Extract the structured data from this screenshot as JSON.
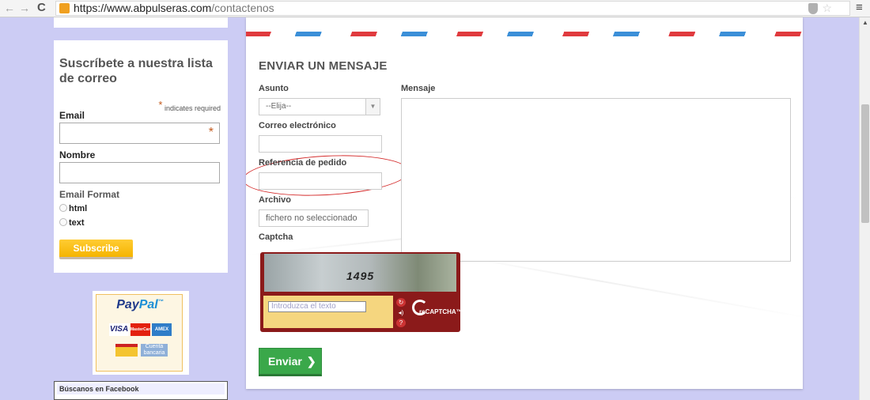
{
  "browser": {
    "url_host": "https://www.abpulseras.com",
    "url_path": "/contactenos",
    "back_glyph": "←",
    "forward_glyph": "→",
    "reload_glyph": "C",
    "star_glyph": "☆",
    "menu_glyph": "≡"
  },
  "sidebar": {
    "subscribe": {
      "title": "Suscríbete a nuestra lista de correo",
      "required_marker": "*",
      "required_note": "indicates required",
      "email_label": "Email",
      "email_value": "",
      "name_label": "Nombre",
      "name_value": "",
      "format_label": "Email Format",
      "format_options": [
        "html",
        "text"
      ],
      "button_label": "Subscribe"
    },
    "paypal": {
      "logo_part1": "Pay",
      "logo_part2": "Pal",
      "trademark": "™",
      "card_visa": "VISA",
      "card_mastercard": "MasterCard",
      "card_amex": "AMEX",
      "bank_label": "Cuenta bancaria"
    },
    "facebook_title": "Búscanos en Facebook"
  },
  "form": {
    "title": "ENVIAR UN MENSAJE",
    "subject_label": "Asunto",
    "subject_selected": "--Elija--",
    "email_label": "Correo electrónico",
    "order_ref_label": "Referencia de pedido",
    "file_label": "Archivo",
    "file_status": "fichero no seleccionado",
    "captcha_label": "Captcha",
    "message_label": "Mensaje",
    "submit_label": "Enviar",
    "submit_chevron": "❯"
  },
  "captcha": {
    "challenge_text": "1495",
    "input_placeholder": "Introduzca el texto",
    "brand": "reCAPTCHA™",
    "refresh_glyph": "↻",
    "audio_glyph": "◂)",
    "help_glyph": "?"
  },
  "colors": {
    "page_background": "#ccccf4",
    "subscribe_button": "#f5b400",
    "submit_button": "#3aa84a",
    "captcha_frame": "#8b1a1a",
    "annotation_ellipse": "#d42a2a",
    "stripe_red": "#e03a3e",
    "stripe_blue": "#3b8fd8"
  }
}
